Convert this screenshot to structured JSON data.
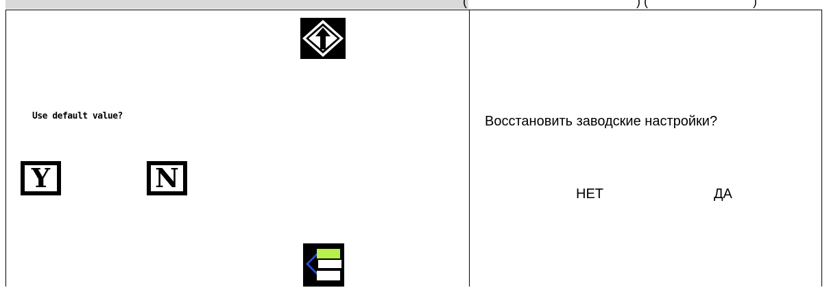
{
  "left_panel": {
    "prompt": "Use default value?",
    "yes_key": "Y",
    "no_key": "N",
    "up_icon": "up-arrow-icon",
    "back_icon": "back-arrow-icon"
  },
  "right_panel": {
    "question": "Восстановить заводские настройки?",
    "no_label": "НЕТ",
    "yes_label": "ДА"
  },
  "colors": {
    "accent_green": "#b7f04a",
    "accent_blue": "#2b4bd8",
    "strip_gray": "#d9d9d9"
  }
}
